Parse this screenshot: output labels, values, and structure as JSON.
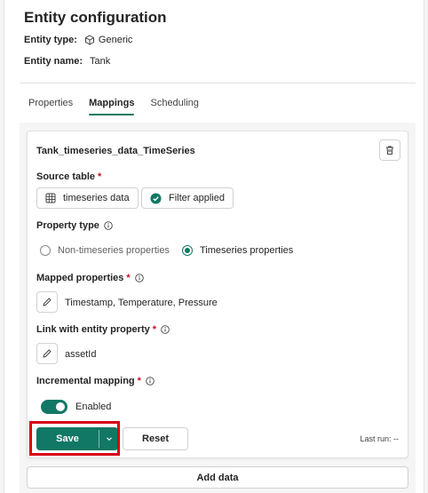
{
  "header": {
    "title": "Entity configuration",
    "entity_type_label": "Entity type:",
    "entity_type_value": "Generic",
    "entity_name_label": "Entity name:",
    "entity_name_value": "Tank"
  },
  "tabs": [
    {
      "label": "Properties",
      "active": false
    },
    {
      "label": "Mappings",
      "active": true
    },
    {
      "label": "Scheduling",
      "active": false
    }
  ],
  "mapping": {
    "title": "Tank_timeseries_data_TimeSeries",
    "source_table_label": "Source table",
    "required_marker": "*",
    "source_table_value": "timeseries data",
    "filter_label": "Filter applied",
    "property_type_label": "Property type",
    "property_type_options": [
      "Non-timeseries properties",
      "Timeseries properties"
    ],
    "property_type_selected": "Timeseries properties",
    "mapped_properties_label": "Mapped properties",
    "mapped_properties_value": "Timestamp, Temperature, Pressure",
    "link_label": "Link with entity property",
    "link_value": "assetId",
    "incremental_label": "Incremental mapping",
    "incremental_state": "Enabled",
    "incremental_enabled": true
  },
  "actions": {
    "save_label": "Save",
    "reset_label": "Reset",
    "last_run": "Last run: --"
  },
  "add_data_label": "Add data",
  "colors": {
    "accent": "#117865",
    "highlight": "#d70015",
    "required": "#c50f1f"
  }
}
